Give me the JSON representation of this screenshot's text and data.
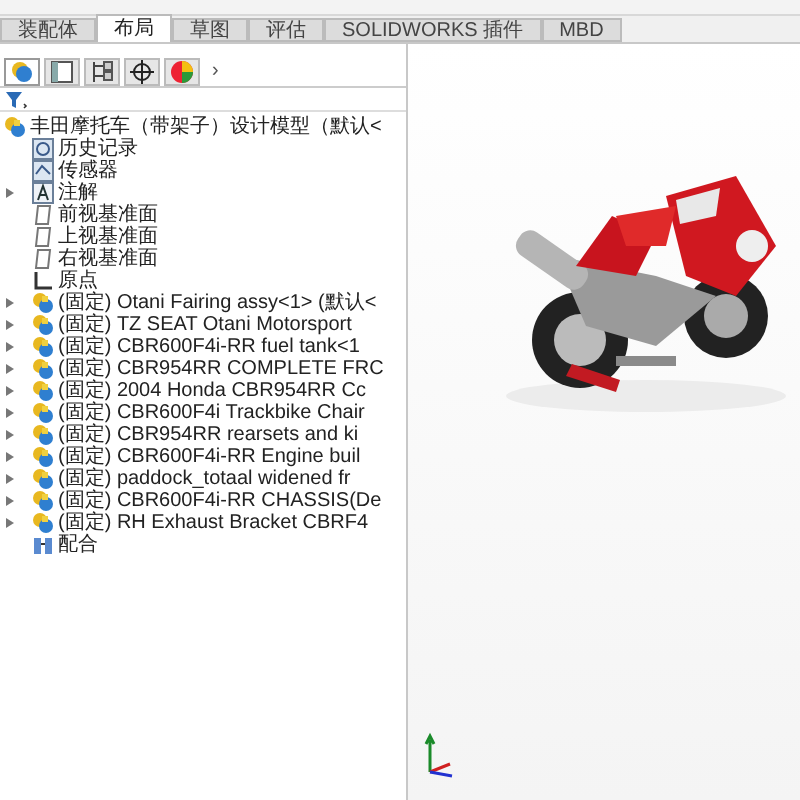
{
  "tabs": [
    {
      "label": "装配体",
      "selected": false
    },
    {
      "label": "布局",
      "selected": true
    },
    {
      "label": "草图",
      "selected": false
    },
    {
      "label": "评估",
      "selected": false
    },
    {
      "label": "SOLIDWORKS 插件",
      "selected": false
    },
    {
      "label": "MBD",
      "selected": false
    }
  ],
  "panel_tabs": [
    {
      "kind": "tree",
      "selected": true
    },
    {
      "kind": "property",
      "selected": false
    },
    {
      "kind": "config",
      "selected": false
    },
    {
      "kind": "target",
      "selected": false
    },
    {
      "kind": "appearance",
      "selected": false
    }
  ],
  "panel_more": "›",
  "tree": {
    "root": "丰田摩托车（带架子）设计模型（默认<",
    "items": [
      {
        "kind": "history",
        "label": "历史记录",
        "expandable": false
      },
      {
        "kind": "sensor",
        "label": "传感器",
        "expandable": false
      },
      {
        "kind": "annotation",
        "label": "注解",
        "expandable": true
      },
      {
        "kind": "plane",
        "label": "前视基准面",
        "expandable": false
      },
      {
        "kind": "plane",
        "label": "上视基准面",
        "expandable": false
      },
      {
        "kind": "plane",
        "label": "右视基准面",
        "expandable": false
      },
      {
        "kind": "origin",
        "label": "原点",
        "expandable": false
      },
      {
        "kind": "part",
        "label": "(固定) Otani Fairing assy<1> (默认<",
        "expandable": true
      },
      {
        "kind": "part",
        "label": "(固定) TZ SEAT Otani Motorsport",
        "expandable": true
      },
      {
        "kind": "part",
        "label": "(固定) CBR600F4i-RR fuel tank<1",
        "expandable": true
      },
      {
        "kind": "part",
        "label": "(固定) CBR954RR COMPLETE FRC",
        "expandable": true
      },
      {
        "kind": "part",
        "label": "(固定) 2004 Honda CBR954RR Cc",
        "expandable": true
      },
      {
        "kind": "part",
        "label": "(固定) CBR600F4i Trackbike Chair",
        "expandable": true
      },
      {
        "kind": "part",
        "label": "(固定) CBR954RR rearsets and ki",
        "expandable": true
      },
      {
        "kind": "part",
        "label": "(固定) CBR600F4i-RR Engine buil",
        "expandable": true
      },
      {
        "kind": "part",
        "label": "(固定) paddock_totaal widened fr",
        "expandable": true
      },
      {
        "kind": "part",
        "label": "(固定) CBR600F4i-RR CHASSIS(De",
        "expandable": true
      },
      {
        "kind": "part",
        "label": "(固定) RH Exhaust Bracket CBRF4",
        "expandable": true
      },
      {
        "kind": "mates",
        "label": "配合",
        "expandable": false
      }
    ]
  }
}
